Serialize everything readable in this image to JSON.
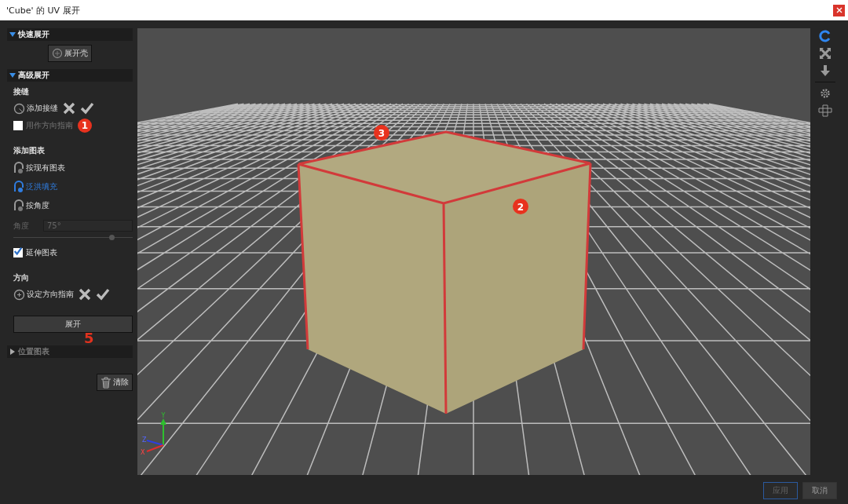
{
  "window": {
    "title": "'Cube' 的 UV 展开"
  },
  "quick_unwrap": {
    "title": "快速展开",
    "expanded": true,
    "button": "展开壳"
  },
  "advanced_unwrap": {
    "title": "高级展开",
    "expanded": true,
    "seams": {
      "heading": "接缝",
      "tool": "添加接缝",
      "option": {
        "label": "用作方向指南",
        "checked": false,
        "marker": "1"
      }
    },
    "add_charts": {
      "heading": "添加图表",
      "modes": [
        {
          "label": "按现有图表",
          "selected": false
        },
        {
          "label": "泛洪填充",
          "selected": true
        },
        {
          "label": "按角度",
          "selected": false
        }
      ],
      "angle": {
        "label": "角度",
        "value": "75°",
        "level": 0.8,
        "disabled": true
      },
      "extend": {
        "label": "延伸图表",
        "checked": true
      }
    },
    "orientation": {
      "heading": "方向",
      "tool": "设定方向指南"
    },
    "unwrap_button": "展开",
    "unwrap_marker": "5"
  },
  "place_charts": {
    "title": "位置图表",
    "expanded": false
  },
  "clear_button": "清除",
  "viewport": {
    "markers": [
      "3",
      "2"
    ],
    "axes": [
      "Y",
      "Z",
      "X"
    ]
  },
  "footer": {
    "buttons": [
      {
        "label": "应用",
        "selected": true
      },
      {
        "label": "取消",
        "selected": false
      }
    ]
  }
}
